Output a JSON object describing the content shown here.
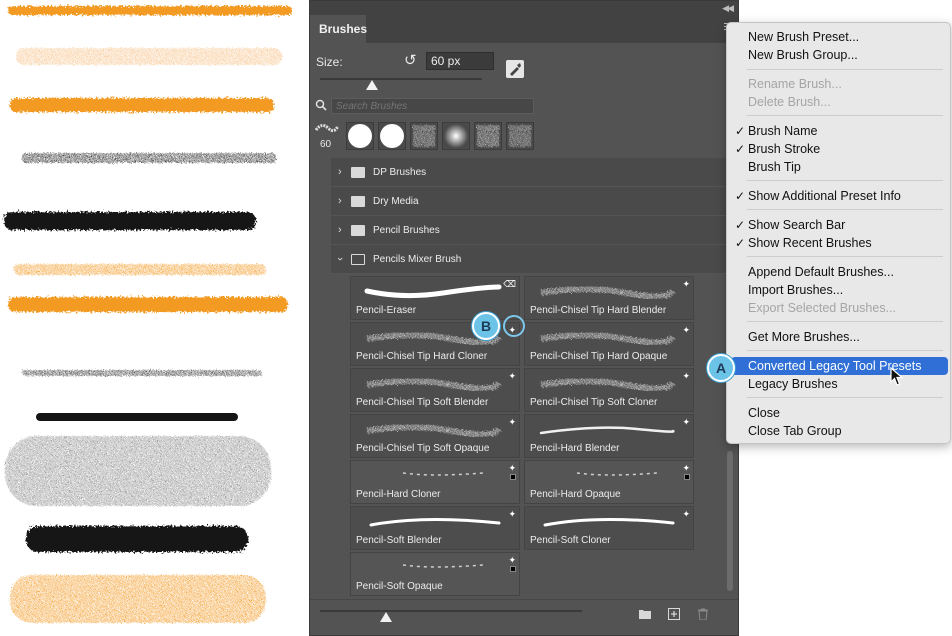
{
  "panel": {
    "tab_label": "Brushes",
    "size_label": "Size:",
    "size_value": "60 px",
    "size_slider_position": 0.32,
    "search_placeholder": "Search Brushes",
    "recent_count": "60",
    "thumbnail_slider_position": 0.25
  },
  "folders": [
    {
      "label": "DP Brushes",
      "expanded": false
    },
    {
      "label": "Dry Media",
      "expanded": false
    },
    {
      "label": "Pencil Brushes",
      "expanded": false
    },
    {
      "label": "Pencils Mixer Brush",
      "expanded": true
    }
  ],
  "brushes": [
    {
      "name": "Pencil-Eraser",
      "tool": "eraser"
    },
    {
      "name": "Pencil-Chisel Tip Hard Blender",
      "tool": "mixer"
    },
    {
      "name": "Pencil-Chisel Tip Hard Cloner",
      "tool": "mixer"
    },
    {
      "name": "Pencil-Chisel Tip Hard Opaque",
      "tool": "mixer"
    },
    {
      "name": "Pencil-Chisel Tip Soft Blender",
      "tool": "mixer"
    },
    {
      "name": "Pencil-Chisel Tip Soft Cloner",
      "tool": "mixer"
    },
    {
      "name": "Pencil-Chisel Tip Soft Opaque",
      "tool": "mixer"
    },
    {
      "name": "Pencil-Hard Blender",
      "tool": "mixer"
    },
    {
      "name": "Pencil-Hard Cloner",
      "tool": "mixer"
    },
    {
      "name": "Pencil-Hard Opaque",
      "tool": "mixer"
    },
    {
      "name": "Pencil-Soft Blender",
      "tool": "mixer"
    },
    {
      "name": "Pencil-Soft Cloner",
      "tool": "mixer"
    },
    {
      "name": "Pencil-Soft Opaque",
      "tool": "mixer"
    }
  ],
  "menu": {
    "new_brush_preset": "New Brush Preset...",
    "new_brush_group": "New Brush Group...",
    "rename_brush": "Rename Brush...",
    "delete_brush": "Delete Brush...",
    "brush_name": "Brush Name",
    "brush_stroke": "Brush Stroke",
    "brush_tip": "Brush Tip",
    "show_additional_preset_info": "Show Additional Preset Info",
    "show_search_bar": "Show Search Bar",
    "show_recent_brushes": "Show Recent Brushes",
    "append_default_brushes": "Append Default Brushes...",
    "import_brushes": "Import Brushes...",
    "export_selected_brushes": "Export Selected Brushes...",
    "get_more_brushes": "Get More Brushes...",
    "converted_legacy_tool_presets": "Converted Legacy Tool Presets",
    "legacy_brushes": "Legacy Brushes",
    "close": "Close",
    "close_tab_group": "Close Tab Group",
    "check_mark": "✓"
  },
  "callouts": {
    "a": "A",
    "b": "B"
  },
  "colors": {
    "orange_stroke": "#f39a24",
    "light_orange_stroke": "#f7c28a",
    "black_stroke": "#141414",
    "gray_stroke": "#8c8c8c",
    "panel_bg": "#535353",
    "menu_highlight": "#2f6fd6",
    "callout": "#6cc3e8"
  }
}
